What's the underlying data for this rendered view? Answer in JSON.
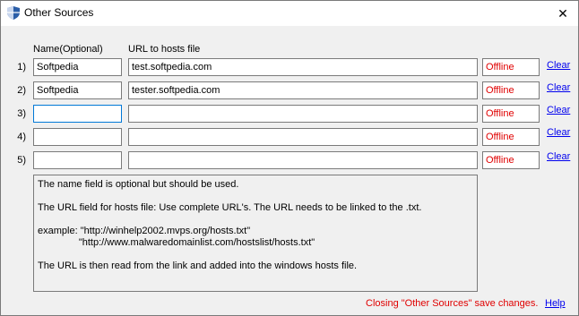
{
  "window": {
    "title": "Other Sources",
    "close_glyph": "✕"
  },
  "headers": {
    "name": "Name(Optional)",
    "url": "URL to hosts file"
  },
  "rows": [
    {
      "num": "1)",
      "name": "Softpedia",
      "url": "test.softpedia.com",
      "status": "Offline",
      "clear": "Clear"
    },
    {
      "num": "2)",
      "name": "Softpedia",
      "url": "tester.softpedia.com",
      "status": "Offline",
      "clear": "Clear"
    },
    {
      "num": "3)",
      "name": "",
      "url": "",
      "status": "Offline",
      "clear": "Clear"
    },
    {
      "num": "4)",
      "name": "",
      "url": "",
      "status": "Offline",
      "clear": "Clear"
    },
    {
      "num": "5)",
      "name": "",
      "url": "",
      "status": "Offline",
      "clear": "Clear"
    }
  ],
  "info": {
    "line1": "The name field is optional but should be used.",
    "line2": "The URL field for hosts file: Use complete URL's. The URL needs to be linked to the .txt.",
    "line3": "example: \"http://winhelp2002.mvps.org/hosts.txt\"",
    "line4": "               \"http://www.malwaredomainlist.com/hostslist/hosts.txt\"",
    "line5": "The URL is then read from the link and added into the windows hosts file."
  },
  "footer": {
    "note": "Closing \"Other Sources\" save changes.",
    "help": "Help"
  },
  "colors": {
    "status": "#e00000",
    "link": "#0000ee",
    "focus": "#0078d7"
  }
}
